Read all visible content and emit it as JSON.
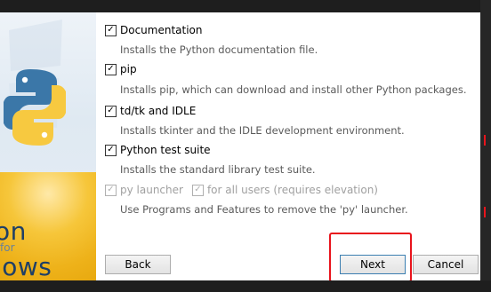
{
  "sidebar": {
    "brand_line1": "on",
    "brand_line2": "for",
    "brand_line3": "lows"
  },
  "options": [
    {
      "label": "Documentation",
      "checked": true,
      "enabled": true,
      "desc": "Installs the Python documentation file."
    },
    {
      "label": "pip",
      "checked": true,
      "enabled": true,
      "desc": "Installs pip, which can download and install other Python packages."
    },
    {
      "label": "td/tk and IDLE",
      "checked": true,
      "enabled": true,
      "desc": "Installs tkinter and the IDLE development environment."
    },
    {
      "label": "Python test suite",
      "checked": true,
      "enabled": true,
      "desc": "Installs the standard library test suite."
    }
  ],
  "launcher": {
    "py_launcher_label": "py launcher",
    "all_users_label": "for all users (requires elevation)",
    "desc": "Use Programs and Features to remove the 'py' launcher."
  },
  "buttons": {
    "back": "Back",
    "next": "Next",
    "cancel": "Cancel"
  },
  "colors": {
    "highlight": "#e8141c"
  }
}
